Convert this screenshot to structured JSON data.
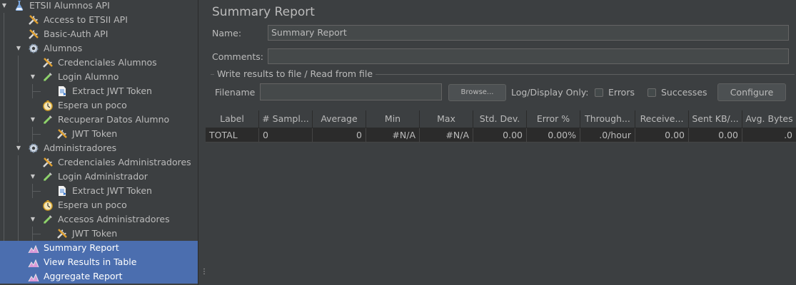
{
  "tree": {
    "items": [
      {
        "label": "ETSII Alumnos API",
        "icon": "flask-icon"
      },
      {
        "label": "Access to ETSII API",
        "icon": "tools-icon"
      },
      {
        "label": "Basic-Auth API",
        "icon": "tools-icon"
      },
      {
        "label": "Alumnos",
        "icon": "gear-icon"
      },
      {
        "label": "Credenciales Alumnos",
        "icon": "tools-icon"
      },
      {
        "label": "Login Alumno",
        "icon": "pipette-icon"
      },
      {
        "label": "Extract JWT Token",
        "icon": "document-icon"
      },
      {
        "label": "Espera un poco",
        "icon": "timer-icon"
      },
      {
        "label": "Recuperar Datos Alumno",
        "icon": "pipette-icon"
      },
      {
        "label": "JWT Token",
        "icon": "tools-icon"
      },
      {
        "label": "Administradores",
        "icon": "gear-icon"
      },
      {
        "label": "Credenciales Administradores",
        "icon": "tools-icon"
      },
      {
        "label": "Login Administrador",
        "icon": "pipette-icon"
      },
      {
        "label": "Extract JWT Token",
        "icon": "document-icon"
      },
      {
        "label": "Espera un poco",
        "icon": "timer-icon"
      },
      {
        "label": "Accesos Administradores",
        "icon": "pipette-icon"
      },
      {
        "label": "JWT Token",
        "icon": "tools-icon"
      },
      {
        "label": "Summary Report",
        "icon": "report-icon"
      },
      {
        "label": "View Results in Table",
        "icon": "report-icon"
      },
      {
        "label": "Aggregate Report",
        "icon": "report-icon"
      }
    ]
  },
  "panel": {
    "title": "Summary Report",
    "name_label": "Name:",
    "name_value": "Summary Report",
    "comments_label": "Comments:",
    "comments_value": "",
    "file_group_legend": "Write results to file / Read from file",
    "filename_label": "Filename",
    "filename_value": "",
    "browse_label": "Browse...",
    "log_display_label": "Log/Display Only:",
    "errors_label": "Errors",
    "successes_label": "Successes",
    "configure_label": "Configure"
  },
  "table": {
    "headers": [
      "Label",
      "# Sampl...",
      "Average",
      "Min",
      "Max",
      "Std. Dev.",
      "Error %",
      "Through...",
      "Receive...",
      "Sent KB/...",
      "Avg. Bytes"
    ],
    "rows": [
      [
        "TOTAL",
        "0",
        "0",
        "#N/A",
        "#N/A",
        "0.00",
        "0.00%",
        ".0/hour",
        "0.00",
        "0.00",
        ".0"
      ]
    ]
  },
  "colors": {
    "selection": "#4b6eaf",
    "background": "#3c3f41",
    "field": "#45494a"
  }
}
